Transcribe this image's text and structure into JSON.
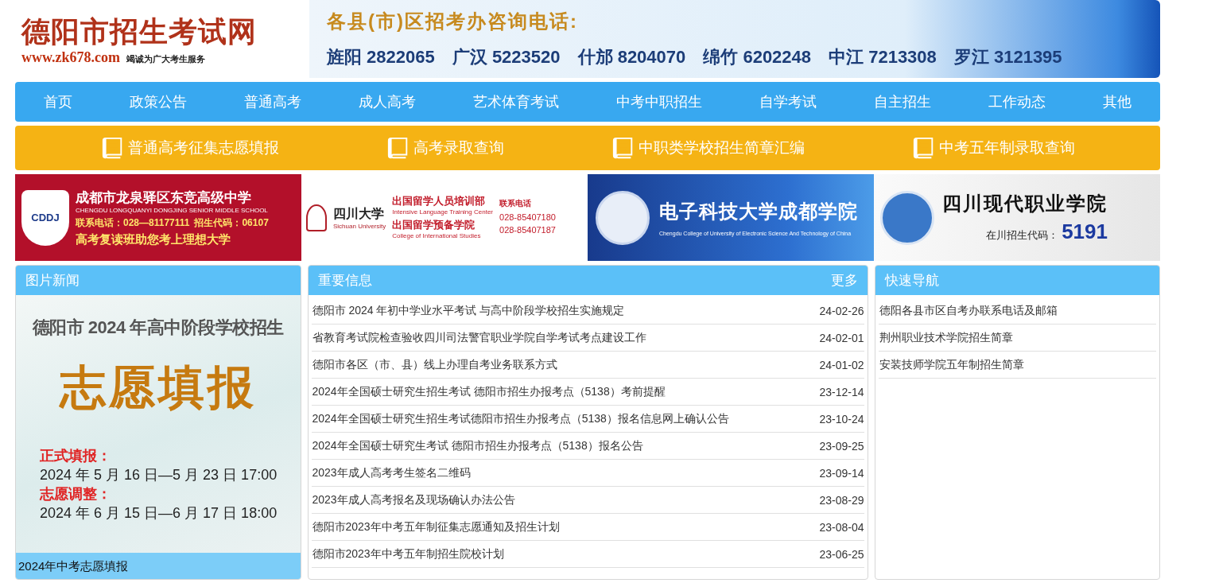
{
  "header": {
    "logo": {
      "title": "德阳市招生考试网",
      "url": "www.zk678.com",
      "slogan": "竭诚为广大考生服务"
    },
    "hotline_banner": {
      "title": "各县(市)区招考办咨询电话:",
      "phones": [
        {
          "area": "旌阳",
          "number": "2822065"
        },
        {
          "area": "广汉",
          "number": "5223520"
        },
        {
          "area": "什邡",
          "number": "8204070"
        },
        {
          "area": "绵竹",
          "number": "6202248"
        },
        {
          "area": "中江",
          "number": "7213308"
        },
        {
          "area": "罗江",
          "number": "3121395"
        }
      ]
    }
  },
  "nav": [
    "首页",
    "政策公告",
    "普通高考",
    "成人高考",
    "艺术体育考试",
    "中考中职招生",
    "自学考试",
    "自主招生",
    "工作动态",
    "其他"
  ],
  "quick_links": [
    "普通高考征集志愿填报",
    "高考录取查询",
    "中职类学校招生简章汇编",
    "中考五年制录取查询"
  ],
  "ads": [
    {
      "kind": "school",
      "logo": "CDDJ",
      "name": "成都市龙泉驿区东竞高级中学",
      "name_en": "CHENGDU LONGQUANYI DONGJING SENIOR MIDDLE SCHOOL",
      "phone": "联系电话：028—81177111",
      "code": "招生代码：06107",
      "slogan": "高考复读班助您考上理想大学"
    },
    {
      "kind": "university",
      "name": "四川大学",
      "name_en": "Sichuan University",
      "lines": [
        {
          "cn": "出国留学人员培训部",
          "en": "Intensive Language Training Center"
        },
        {
          "cn": "出国留学预备学院",
          "en": "College of International Studies"
        }
      ],
      "phone_label": "联系电话",
      "phones": [
        "028-85407180",
        "028-85407187"
      ]
    },
    {
      "kind": "college",
      "name": "电子科技大学成都学院",
      "name_en": "Chengdu College of University of Electronic Science And Technology of China"
    },
    {
      "kind": "vocational",
      "name": "四川现代职业学院",
      "code_label": "在川招生代码：",
      "code": "5191"
    }
  ],
  "photo_news": {
    "title": "图片新闻",
    "poster": {
      "heading": "德阳市 2024 年高中阶段学校招生",
      "main": "志愿填报",
      "items": [
        {
          "label": "正式填报：",
          "dates": "2024 年 5 月 16 日—5 月 23 日 17:00"
        },
        {
          "label": "志愿调整：",
          "dates": "2024 年 6 月 15 日—6 月 17 日 18:00"
        }
      ]
    },
    "caption": "2024年中考志愿填报"
  },
  "important": {
    "title": "重要信息",
    "more": "更多",
    "items": [
      {
        "title": "德阳市 2024 年初中学业水平考试 与高中阶段学校招生实施规定",
        "date": "24-02-26"
      },
      {
        "title": "省教育考试院检查验收四川司法警官职业学院自学考试考点建设工作",
        "date": "24-02-01"
      },
      {
        "title": "德阳市各区（市、县）线上办理自考业务联系方式",
        "date": "24-01-02"
      },
      {
        "title": "2024年全国硕士研究生招生考试 德阳市招生办报考点（5138）考前提醒",
        "date": "23-12-14"
      },
      {
        "title": "2024年全国硕士研究生招生考试德阳市招生办报考点（5138）报名信息网上确认公告",
        "date": "23-10-24"
      },
      {
        "title": "2024年全国硕士研究生考试 德阳市招生办报考点（5138）报名公告",
        "date": "23-09-25"
      },
      {
        "title": "2023年成人高考考生签名二维码",
        "date": "23-09-14"
      },
      {
        "title": "2023年成人高考报名及现场确认办法公告",
        "date": "23-08-29"
      },
      {
        "title": "德阳市2023年中考五年制征集志愿通知及招生计划",
        "date": "23-08-04"
      },
      {
        "title": "德阳市2023年中考五年制招生院校计划",
        "date": "23-06-25"
      }
    ]
  },
  "quick_nav": {
    "title": "快速导航",
    "items": [
      "德阳各县市区自考办联系电话及邮箱",
      "荆州职业技术学院招生简章",
      "安装技师学院五年制招生简章"
    ]
  }
}
